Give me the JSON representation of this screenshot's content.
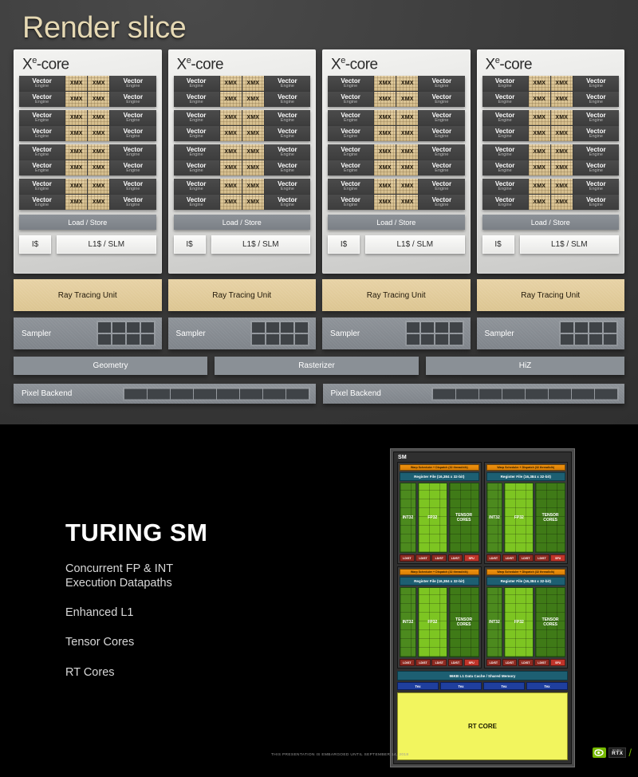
{
  "render_slice": {
    "title": "Render slice",
    "xe_cores": [
      {
        "title_main": "X",
        "title_sup": "e",
        "title_rest": "-core"
      },
      {
        "title_main": "X",
        "title_sup": "e",
        "title_rest": "-core"
      },
      {
        "title_main": "X",
        "title_sup": "e",
        "title_rest": "-core"
      },
      {
        "title_main": "X",
        "title_sup": "e",
        "title_rest": "-core"
      }
    ],
    "vector_engine_label": "Vector",
    "vector_engine_sub": "Engine",
    "xmx_label": "XMX",
    "load_store_label": "Load / Store",
    "icache_label": "I$",
    "l1_slm_label": "L1$ / SLM",
    "vector_engine_groups_per_core": 4,
    "vector_engine_rows_per_group": 2,
    "ray_tracing_units": [
      "Ray Tracing Unit",
      "Ray Tracing Unit",
      "Ray Tracing Unit",
      "Ray Tracing Unit"
    ],
    "samplers": [
      "Sampler",
      "Sampler",
      "Sampler",
      "Sampler"
    ],
    "sampler_grid_cells": 8,
    "fixed_function": [
      {
        "label": "Geometry"
      },
      {
        "label": "Rasterizer"
      },
      {
        "label": "HiZ"
      }
    ],
    "pixel_backends": [
      "Pixel Backend",
      "Pixel Backend"
    ],
    "pixel_backend_cells": 8,
    "colors": {
      "title": "#e6d9b4",
      "ray_tracing_unit": "#dcc591",
      "xmx": "#d4bd8c",
      "block_gray": "#8a9096"
    }
  },
  "turing": {
    "title": "TURING SM",
    "bullets": [
      "Concurrent FP & INT\nExecution Datapaths",
      "Enhanced L1",
      "Tensor Cores",
      "RT Cores"
    ],
    "embargo_notice": "THIS PRESENTATION IS EMBARGOED UNTIL SEPTEMBER 14, 2018",
    "logo": {
      "brand_small": "NVIDIA.",
      "brand_big": "RTX",
      "accent_color": "#76b900"
    },
    "sm_diagram": {
      "sm_label": "SM",
      "warp_scheduler": "Warp Scheduler + Dispatch (32 thread/clk)",
      "register_file": "Register File (16,384 x 32-bit)",
      "units": {
        "int32": "INT32",
        "fp32": "FP32",
        "tensor": "TENSOR\nCORES"
      },
      "ld_st": "LD/ST",
      "sfu": "SFU",
      "ld_st_count": 4,
      "l1_cache": "96KB L1 Data Cache / Shared Memory",
      "tex": "Tex",
      "tex_count": 4,
      "rt_core": "RT CORE",
      "quad_count": 4,
      "colors": {
        "warp": "#f0920e",
        "register_file": "#1d5f72",
        "int32": "#4c8a1e",
        "fp32": "#7dc522",
        "tensor": "#3f7a17",
        "ld_st": "#8e2b22",
        "sfu": "#c0342a",
        "tex": "#1f3f9e",
        "rt_core": "#f2f55e"
      }
    }
  }
}
